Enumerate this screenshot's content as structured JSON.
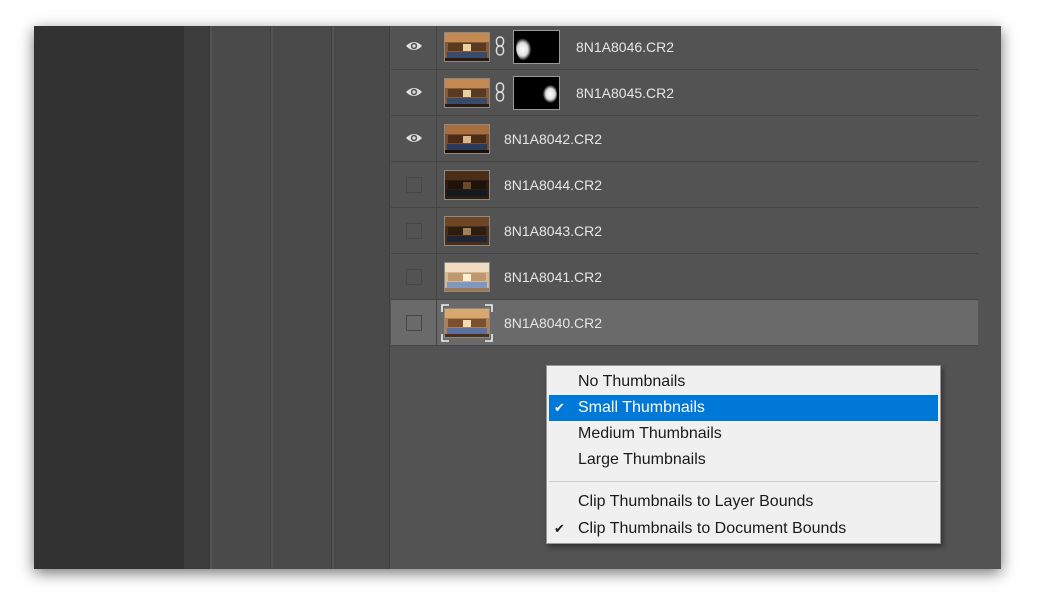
{
  "layers": [
    {
      "name": "8N1A8046.CR2",
      "visible": true,
      "has_mask": true,
      "selected": false
    },
    {
      "name": "8N1A8045.CR2",
      "visible": true,
      "has_mask": true,
      "selected": false
    },
    {
      "name": "8N1A8042.CR2",
      "visible": true,
      "has_mask": false,
      "selected": false
    },
    {
      "name": "8N1A8044.CR2",
      "visible": false,
      "has_mask": false,
      "selected": false
    },
    {
      "name": "8N1A8043.CR2",
      "visible": false,
      "has_mask": false,
      "selected": false
    },
    {
      "name": "8N1A8041.CR2",
      "visible": false,
      "has_mask": false,
      "selected": false
    },
    {
      "name": "8N1A8040.CR2",
      "visible": false,
      "has_mask": false,
      "selected": true
    }
  ],
  "context_menu": {
    "items": [
      {
        "label": "No Thumbnails",
        "checked": false,
        "highlighted": false
      },
      {
        "label": "Small Thumbnails",
        "checked": true,
        "highlighted": true
      },
      {
        "label": "Medium Thumbnails",
        "checked": false,
        "highlighted": false
      },
      {
        "label": "Large Thumbnails",
        "checked": false,
        "highlighted": false
      },
      {
        "label": "Clip Thumbnails to Layer Bounds",
        "checked": false,
        "highlighted": false
      },
      {
        "label": "Clip Thumbnails to Document Bounds",
        "checked": true,
        "highlighted": false
      }
    ],
    "checkmark": "✔"
  },
  "colors": {
    "highlight": "#0078d7",
    "panel": "#535353",
    "menu_bg": "#f0f0f0"
  }
}
